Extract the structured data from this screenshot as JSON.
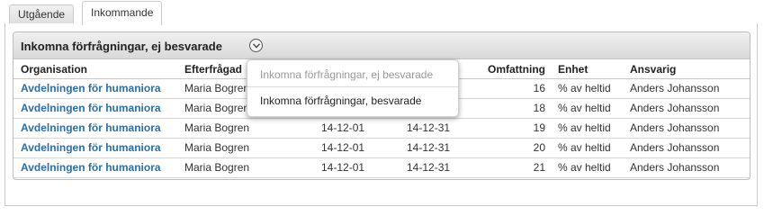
{
  "tabs": [
    {
      "label": "Utgående"
    },
    {
      "label": "Inkommande"
    }
  ],
  "panel": {
    "title": "Inkomna förfrågningar, ej besvarade"
  },
  "dropdown": {
    "current": "Inkomna förfrågningar, ej besvarade",
    "options": [
      "Inkomna förfrågningar, besvarade"
    ]
  },
  "table": {
    "columns": [
      "Organisation",
      "Efterfrågad",
      "",
      "",
      "Omfattning",
      "Enhet",
      "Ansvarig"
    ],
    "rows": [
      {
        "organisation": "Avdelningen för humaniora",
        "efterfragad": "Maria Bogren",
        "start": "",
        "end": "",
        "omfattning": "16",
        "enhet": "% av heltid",
        "ansvarig": "Anders Johansson"
      },
      {
        "organisation": "Avdelningen för humaniora",
        "efterfragad": "Maria Bogren",
        "start": "",
        "end": "",
        "omfattning": "18",
        "enhet": "% av heltid",
        "ansvarig": "Anders Johansson"
      },
      {
        "organisation": "Avdelningen för humaniora",
        "efterfragad": "Maria Bogren",
        "start": "14-12-01",
        "end": "14-12-31",
        "omfattning": "19",
        "enhet": "% av heltid",
        "ansvarig": "Anders Johansson"
      },
      {
        "organisation": "Avdelningen för humaniora",
        "efterfragad": "Maria Bogren",
        "start": "14-12-01",
        "end": "14-12-31",
        "omfattning": "20",
        "enhet": "% av heltid",
        "ansvarig": "Anders Johansson"
      },
      {
        "organisation": "Avdelningen för humaniora",
        "efterfragad": "Maria Bogren",
        "start": "14-12-01",
        "end": "14-12-31",
        "omfattning": "21",
        "enhet": "% av heltid",
        "ansvarig": "Anders Johansson"
      }
    ]
  },
  "colors": {
    "link": "#2a6fa8",
    "header_bg": "#d9d9d9",
    "border": "#c9c9c9"
  },
  "icons": {
    "toggle": "chevron-down-circle-icon"
  }
}
